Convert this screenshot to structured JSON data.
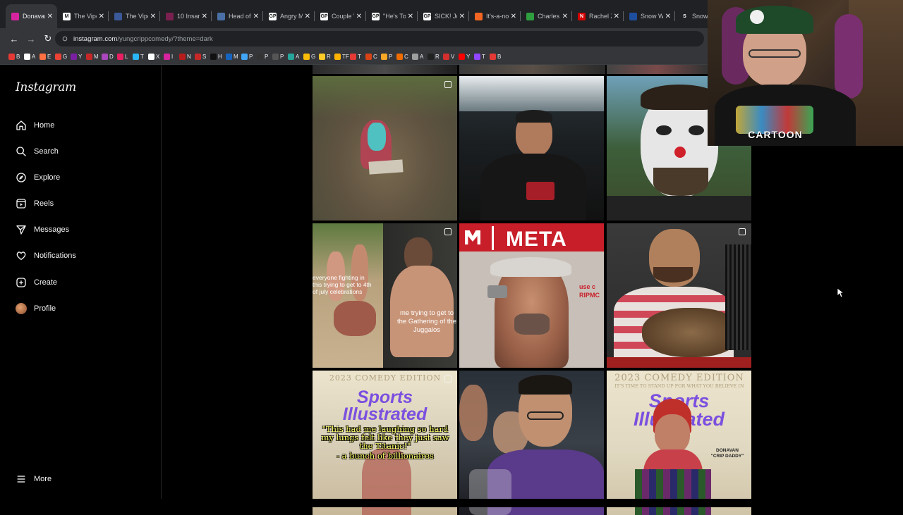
{
  "browser": {
    "tabs": [
      {
        "label": "Donavan",
        "color": "#d6249f",
        "fav": "",
        "active": true
      },
      {
        "label": "The Vipe",
        "color": "#ffffff",
        "fav": "M",
        "active": false
      },
      {
        "label": "The Vipe",
        "color": "#3b5998",
        "fav": "",
        "active": false
      },
      {
        "label": "10 Insan",
        "color": "#7a2050",
        "fav": "",
        "active": false
      },
      {
        "label": "Head of",
        "color": "#4a6fa5",
        "fav": "",
        "active": false
      },
      {
        "label": "Angry M",
        "color": "#ffffff",
        "fav": "GP",
        "active": false
      },
      {
        "label": "Couple V",
        "color": "#ffffff",
        "fav": "GP",
        "active": false
      },
      {
        "label": "\"He's To",
        "color": "#ffffff",
        "fav": "GP",
        "active": false
      },
      {
        "label": "SICK! Jo",
        "color": "#ffffff",
        "fav": "GP",
        "active": false
      },
      {
        "label": "It's-a-no",
        "color": "#f26522",
        "fav": "",
        "active": false
      },
      {
        "label": "Charles",
        "color": "#2e9e3f",
        "fav": "",
        "active": false
      },
      {
        "label": "Rachel Z",
        "color": "#d50000",
        "fav": "N",
        "active": false
      },
      {
        "label": "Snow W",
        "color": "#1e4e9e",
        "fav": "",
        "active": false
      },
      {
        "label": "Snow",
        "color": "#202124",
        "fav": "S",
        "active": false
      }
    ],
    "url_domain": "instagram.com",
    "url_path": "/yungcrippcomedy/?theme=dark",
    "bookmarks": [
      {
        "label": "B",
        "color": "#e53935"
      },
      {
        "label": "A",
        "color": "#ffffff"
      },
      {
        "label": "E",
        "color": "#ff7043"
      },
      {
        "label": "G",
        "color": "#ea4335"
      },
      {
        "label": "Y",
        "color": "#7b1fa2"
      },
      {
        "label": "M",
        "color": "#c62828"
      },
      {
        "label": "D",
        "color": "#ab47bc"
      },
      {
        "label": "L",
        "color": "#e91e63"
      },
      {
        "label": "T",
        "color": "#29b6f6"
      },
      {
        "label": "X",
        "color": "#ffffff"
      },
      {
        "label": "I",
        "color": "#d6249f"
      },
      {
        "label": "N",
        "color": "#b71c1c"
      },
      {
        "label": "S",
        "color": "#c62828"
      },
      {
        "label": "H",
        "color": "#111111"
      },
      {
        "label": "M",
        "color": "#1565c0"
      },
      {
        "label": "P",
        "color": "#42a5f5"
      },
      {
        "label": "P",
        "color": "#333333"
      },
      {
        "label": "P",
        "color": "#555555"
      },
      {
        "label": "A",
        "color": "#26a69a"
      },
      {
        "label": "G",
        "color": "#fbbc05"
      },
      {
        "label": "R",
        "color": "#ffca28"
      },
      {
        "label": "TF",
        "color": "#ffb300"
      },
      {
        "label": "T",
        "color": "#e53935"
      },
      {
        "label": "C",
        "color": "#d84315"
      },
      {
        "label": "P",
        "color": "#f9a825"
      },
      {
        "label": "C",
        "color": "#ef6c00"
      },
      {
        "label": "A",
        "color": "#9e9e9e"
      },
      {
        "label": "R",
        "color": "#212121"
      },
      {
        "label": "V",
        "color": "#d32f2f"
      },
      {
        "label": "Y",
        "color": "#ff0000"
      },
      {
        "label": "T",
        "color": "#9146ff"
      },
      {
        "label": "B",
        "color": "#e53935"
      }
    ]
  },
  "sidebar": {
    "logo": "Instagram",
    "items": [
      {
        "label": "Home",
        "icon": "home-icon"
      },
      {
        "label": "Search",
        "icon": "search-icon"
      },
      {
        "label": "Explore",
        "icon": "compass-icon"
      },
      {
        "label": "Reels",
        "icon": "reels-icon"
      },
      {
        "label": "Messages",
        "icon": "send-icon"
      },
      {
        "label": "Notifications",
        "icon": "heart-icon"
      },
      {
        "label": "Create",
        "icon": "plus-square-icon"
      },
      {
        "label": "Profile",
        "icon": "avatar"
      }
    ],
    "more_label": "More"
  },
  "posts": [
    {
      "id": "dirt-rock",
      "caption": ""
    },
    {
      "id": "man-night-event",
      "caption": ""
    },
    {
      "id": "clown-face",
      "caption": ""
    },
    {
      "id": "fighting-meme",
      "caption_left": "everyone fighting in this trying to get to 4th of july celebrations",
      "caption_right": "me trying to get to the Gathering of the Juggalos"
    },
    {
      "id": "meta-ad",
      "headline": "META",
      "side_text": "use c\nRIPMC"
    },
    {
      "id": "man-with-cat",
      "caption": ""
    },
    {
      "id": "sports-illustrated-1",
      "header": "2023 COMEDY EDITION",
      "title": "Sports\nIllustrated",
      "quote": "\"This had me laughing so hard my lungs felt like they just saw the Titanic!\"",
      "attribution": "- a bunch of billionaires"
    },
    {
      "id": "man-restaurant",
      "caption": ""
    },
    {
      "id": "sports-illustrated-2",
      "header": "2023 COMEDY EDITION",
      "subheader": "IT'S TIME TO STAND UP FOR WHAT YOU BELIEVE IN",
      "title": "Sports\nIllustrated",
      "name_tag": "DONAVAN\n\"CRIP DADDY\""
    }
  ],
  "webcam": {
    "shirt_text": "CARTOON"
  }
}
